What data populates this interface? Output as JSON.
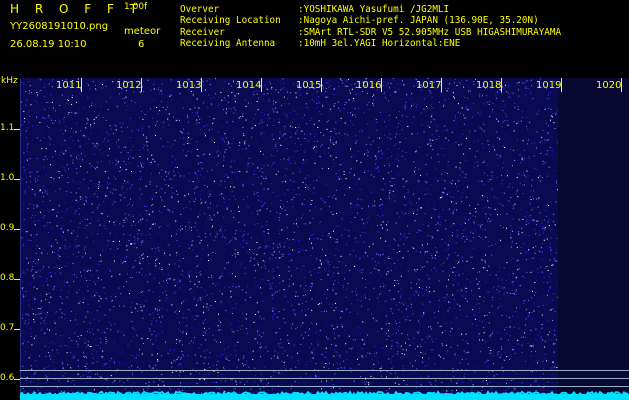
{
  "header": {
    "brand": "H R O F F T",
    "version": "1.00f",
    "filename": "YY2608191010.png",
    "datetime": "26.08.19 10:10",
    "meteor_label": "meteor",
    "meteor_count": "6"
  },
  "info": [
    {
      "key": "Overver",
      "value": ":YOSHIKAWA Yasufumi /JG2MLI"
    },
    {
      "key": "Receiving Location",
      "value": ":Nagoya Aichi-pref. JAPAN (136.90E, 35.20N)"
    },
    {
      "key": "Receiver",
      "value": ":SMArt RTL-SDR V5 52.905MHz USB HIGASHIMURAYAMA"
    },
    {
      "key": "Receiving Antenna",
      "value": ":10mH 3el.YAGI Horizontal:ENE"
    }
  ],
  "axis": {
    "y_unit": "kHz",
    "y_ticks": [
      "1.1",
      "1.0",
      "0.9",
      "0.8",
      "0.7",
      "0.6"
    ],
    "x_ticks": [
      "1011",
      "1012",
      "1013",
      "1014",
      "1015",
      "1016",
      "1017",
      "1018",
      "1019",
      "1020"
    ]
  },
  "colors": {
    "text": "#ffff00",
    "background": "#000000",
    "spectrogram": "#0a0a52",
    "noise_trace": "#00e0ff"
  }
}
